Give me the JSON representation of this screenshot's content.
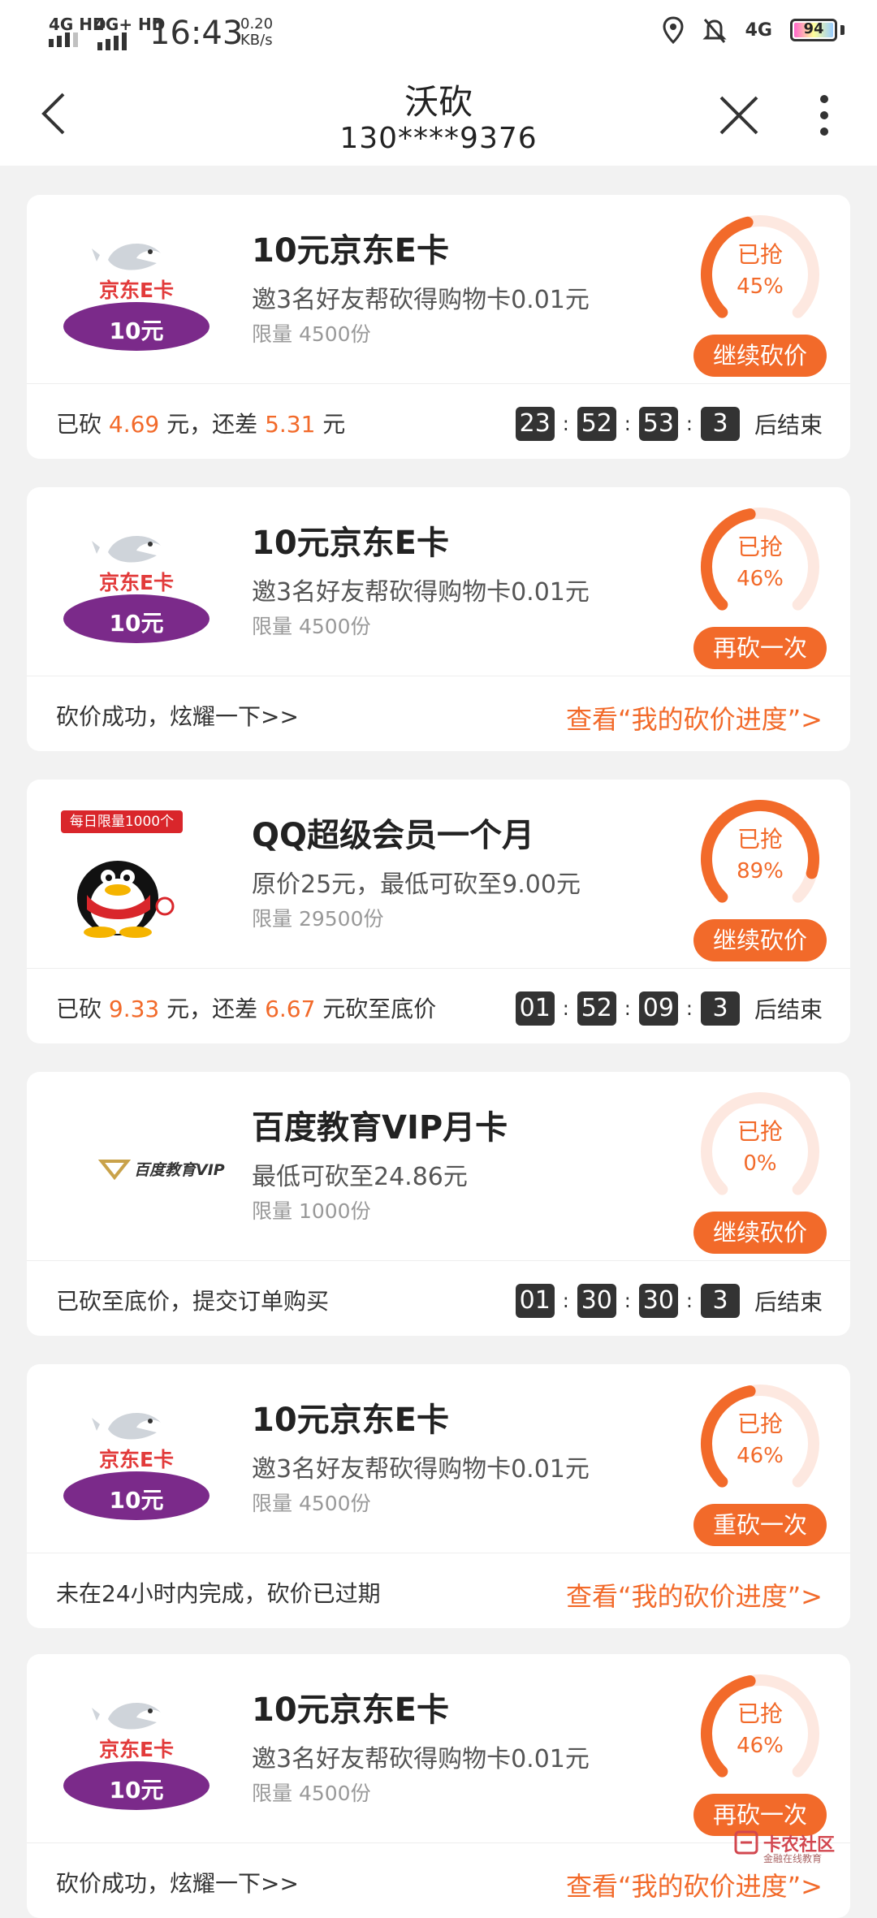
{
  "status_bar": {
    "net1": "4G HD",
    "net2": "4G+ HD",
    "time": "16:43",
    "speed_value": "0.20",
    "speed_unit": "KB/s",
    "net3": "4G",
    "battery": "94"
  },
  "nav": {
    "title": "沃砍",
    "subtitle": "130****9376"
  },
  "cards": [
    {
      "title": "10元京东E卡",
      "desc": "邀3名好友帮砍得购物卡0.01元",
      "limit": "限量 4500份",
      "ring_label": "已抢",
      "ring_pct_text": "45%",
      "ring_pct": 45,
      "button": "继续砍价",
      "b_prefix": "已砍 ",
      "b_v1": "4.69",
      "b_mid": " 元，还差 ",
      "b_v2": "5.31",
      "b_suffix": " 元",
      "cd": [
        "23",
        "52",
        "53",
        "3"
      ],
      "cd_suffix": "后结束"
    },
    {
      "title": "10元京东E卡",
      "desc": "邀3名好友帮砍得购物卡0.01元",
      "limit": "限量 4500份",
      "ring_label": "已抢",
      "ring_pct_text": "46%",
      "ring_pct": 46,
      "button": "再砍一次",
      "b_text": "砍价成功，炫耀一下>>",
      "link": "查看“我的砍价进度”>"
    },
    {
      "title": "QQ超级会员一个月",
      "desc": "原价25元，最低可砍至9.00元",
      "limit": "限量 29500份",
      "ring_label": "已抢",
      "ring_pct_text": "89%",
      "ring_pct": 89,
      "button": "继续砍价",
      "badge": "每日限量1000个",
      "b_prefix": "已砍 ",
      "b_v1": "9.33",
      "b_mid": " 元，还差 ",
      "b_v2": "6.67",
      "b_suffix": " 元砍至底价",
      "cd": [
        "01",
        "52",
        "09",
        "3"
      ],
      "cd_suffix": "后结束"
    },
    {
      "title": "百度教育VIP月卡",
      "desc": "最低可砍至24.86元",
      "limit": "限量 1000份",
      "ring_label": "已抢",
      "ring_pct_text": "0%",
      "ring_pct": 0,
      "button": "继续砍价",
      "logo_text": "百度教育VIP",
      "b_text": "已砍至底价，提交订单购买",
      "cd": [
        "01",
        "30",
        "30",
        "3"
      ],
      "cd_suffix": "后结束"
    },
    {
      "title": "10元京东E卡",
      "desc": "邀3名好友帮砍得购物卡0.01元",
      "limit": "限量 4500份",
      "ring_label": "已抢",
      "ring_pct_text": "46%",
      "ring_pct": 46,
      "button": "重砍一次",
      "b_text": "未在24小时内完成，砍价已过期",
      "link": "查看“我的砍价进度”>"
    },
    {
      "title": "10元京东E卡",
      "desc": "邀3名好友帮砍得购物卡0.01元",
      "limit": "限量 4500份",
      "ring_label": "已抢",
      "ring_pct_text": "46%",
      "ring_pct": 46,
      "button": "再砍一次",
      "b_text": "砍价成功，炫耀一下>>",
      "link": "查看“我的砍价进度”>"
    }
  ],
  "jd_card": {
    "brand": "京东E卡",
    "amount": "10元"
  },
  "watermark": {
    "main": "卡农社区",
    "sub": "金融在线教育"
  },
  "colors": {
    "accent": "#f26a2a",
    "ring_track": "#fde8e0",
    "jd_purple": "#7b2a8a",
    "jd_red": "#e23b3b"
  }
}
